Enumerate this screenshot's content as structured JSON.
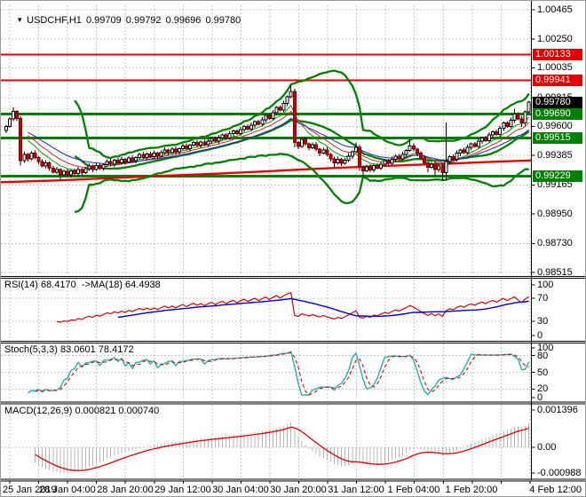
{
  "title": {
    "dropdown_icon": "▼",
    "symbol_period": "USDCHF,H1",
    "open": "0.99709",
    "high": "0.99792",
    "low": "0.99696",
    "close": "0.99780"
  },
  "indicator_labels": {
    "rsi": "RSI(14) 68.4170  ->MA(18) 64.4938",
    "stoch": "Stoch(5,3,3) 83.0601 78.4172",
    "macd": "MACD(12,26,9) 0.000821 0.000740"
  },
  "colors": {
    "background": "#ffffff",
    "grid": "#c6c6c6",
    "resistance_line": "#e60000",
    "support_line": "#008000",
    "current_price_badge_bg": "#000000",
    "bull_body": "#ffffff",
    "bear_body": "#d40000",
    "bear_border": "#7a0000",
    "candle_outline": "#000000",
    "band_green": "#008000",
    "ribbon_fast": "#00a000",
    "ribbon_mid": "#dd2222",
    "ribbon_slow": "#2222cc",
    "slow_ma_red": "#e60000",
    "rsi_line": "#dd0000",
    "rsi_ma_line": "#0000cc",
    "stoch_k": "#20b2aa",
    "stoch_d": "#e00000",
    "macd_histogram": "#b4b4b4",
    "macd_signal": "#e00000",
    "panel_border": "#000000"
  },
  "chart_data": {
    "type": "candlestick",
    "symbol": "USDCHF",
    "timeframe": "H1",
    "price_axis_ticks": [
      {
        "label": "1.00465",
        "value": 1.00465
      },
      {
        "label": "1.00250",
        "value": 1.0025
      },
      {
        "label": "1.00035",
        "value": 1.00035
      },
      {
        "label": "0.99815",
        "value": 0.99815
      },
      {
        "label": "0.99600",
        "value": 0.996
      },
      {
        "label": "0.99385",
        "value": 0.99385
      },
      {
        "label": "0.99165",
        "value": 0.99165
      },
      {
        "label": "0.98950",
        "value": 0.9895
      },
      {
        "label": "0.98730",
        "value": 0.9873
      },
      {
        "label": "0.98515",
        "value": 0.98515
      }
    ],
    "time_axis_ticks": [
      "25 Jan 2019",
      "28 Jan 04:00",
      "28 Jan 20:00",
      "29 Jan 12:00",
      "30 Jan 04:00",
      "30 Jan 20:00",
      "31 Jan 12:00",
      "1 Feb 04:00",
      "1 Feb 20:00",
      "4 Feb 12:00"
    ],
    "levels": [
      {
        "label": "1.00133",
        "value": 1.00133,
        "color": "#e60000",
        "width": 2,
        "kind": "resistance"
      },
      {
        "label": "0.99941",
        "value": 0.99941,
        "color": "#e60000",
        "width": 2,
        "kind": "resistance"
      },
      {
        "label": "0.99690",
        "value": 0.9969,
        "color": "#008000",
        "width": 3,
        "kind": "support"
      },
      {
        "label": "0.99515",
        "value": 0.99515,
        "color": "#008000",
        "width": 3,
        "kind": "support"
      },
      {
        "label": "0.99229",
        "value": 0.99229,
        "color": "#008000",
        "width": 3,
        "kind": "support"
      }
    ],
    "current_price": {
      "label": "0.99780",
      "value": 0.9978
    },
    "candles": {
      "open_first": 0.9957,
      "closes": [
        0.996,
        0.99655,
        0.9971,
        0.9966,
        0.99345,
        0.9939,
        0.9936,
        0.994,
        0.9937,
        0.9934,
        0.99305,
        0.9933,
        0.9929,
        0.9926,
        0.9928,
        0.9924,
        0.99265,
        0.9924,
        0.9927,
        0.9925,
        0.9928,
        0.99255,
        0.99285,
        0.99305,
        0.9928,
        0.9931,
        0.9929,
        0.99315,
        0.9934,
        0.9932,
        0.9935,
        0.9933,
        0.99355,
        0.99335,
        0.99365,
        0.99345,
        0.9937,
        0.9939,
        0.9937,
        0.99395,
        0.99375,
        0.994,
        0.9938,
        0.99405,
        0.99425,
        0.99405,
        0.9943,
        0.9941,
        0.99435,
        0.99455,
        0.99435,
        0.9946,
        0.9948,
        0.9946,
        0.99485,
        0.99465,
        0.9949,
        0.9951,
        0.9949,
        0.99515,
        0.99535,
        0.99515,
        0.99545,
        0.99565,
        0.99545,
        0.99575,
        0.996,
        0.9958,
        0.9961,
        0.99635,
        0.99615,
        0.9965,
        0.9968,
        0.9966,
        0.997,
        0.9974,
        0.9972,
        0.9977,
        0.9982,
        0.9986,
        0.9948,
        0.9945,
        0.99505,
        0.9947,
        0.9944,
        0.99465,
        0.9943,
        0.994,
        0.99425,
        0.9939,
        0.9936,
        0.9933,
        0.99355,
        0.99325,
        0.9935,
        0.9938,
        0.9941,
        0.99445,
        0.993,
        0.9927,
        0.993,
        0.99275,
        0.9931,
        0.9929,
        0.9932,
        0.99345,
        0.99325,
        0.99355,
        0.9938,
        0.9936,
        0.9939,
        0.9942,
        0.99455,
        0.9943,
        0.994,
        0.99365,
        0.9933,
        0.99295,
        0.9932,
        0.9928,
        0.99305,
        0.99255,
        0.9934,
        0.99375,
        0.99355,
        0.994,
        0.99425,
        0.99405,
        0.99445,
        0.9947,
        0.9945,
        0.9949,
        0.99515,
        0.99495,
        0.99535,
        0.9956,
        0.9954,
        0.99585,
        0.99625,
        0.996,
        0.99645,
        0.9969,
        0.99655,
        0.99625,
        0.99709,
        0.9978
      ],
      "wicks": {
        "2": {
          "h": 0.9974
        },
        "4": {
          "l": 0.9931
        },
        "15": {
          "l": 0.99195
        },
        "79": {
          "h": 0.99905
        },
        "80": {
          "l": 0.99445
        },
        "91": {
          "l": 0.9929
        },
        "97": {
          "h": 0.9948
        },
        "98": {
          "l": 0.9927
        },
        "99": {
          "l": 0.99225
        },
        "112": {
          "h": 0.99505
        },
        "117": {
          "l": 0.9926
        },
        "119": {
          "l": 0.9923
        },
        "121": {
          "l": 0.99195
        },
        "122": {
          "h": 0.9963,
          "l": 0.992
        },
        "141": {
          "h": 0.9973
        },
        "143": {
          "l": 0.99595
        },
        "145": {
          "h": 0.99792,
          "l": 0.99696
        }
      }
    },
    "slow_red_ma_points": [
      [
        0,
        0.99185
      ],
      [
        60,
        0.99198
      ],
      [
        120,
        0.99215
      ],
      [
        180,
        0.99232
      ],
      [
        240,
        0.99248
      ],
      [
        300,
        0.99266
      ],
      [
        340,
        0.9928
      ],
      [
        380,
        0.99292
      ],
      [
        440,
        0.99308
      ],
      [
        500,
        0.99322
      ],
      [
        560,
        0.99338
      ],
      [
        597,
        0.99347
      ]
    ],
    "indicators": {
      "bollinger": {
        "period": 20,
        "deviation": 2.8
      },
      "ema_ribbon_periods": [
        8,
        13,
        21
      ],
      "rsi": {
        "period": 14,
        "ma_period": 18,
        "value": 68.417,
        "ma_value": 64.4938,
        "scale_labels": [
          {
            "label": "100",
            "value": 100
          },
          {
            "label": "70",
            "value": 70
          },
          {
            "label": "30",
            "value": 30
          },
          {
            "label": "0",
            "value": 0
          }
        ],
        "level_lines": [
          70,
          30
        ]
      },
      "stoch": {
        "k": 5,
        "d": 3,
        "slowing": 3,
        "value": 83.0601,
        "signal_value": 78.4172,
        "scale_labels": [
          {
            "label": "100",
            "value": 100
          },
          {
            "label": "80",
            "value": 80
          },
          {
            "label": "50",
            "value": 50
          },
          {
            "label": "20",
            "value": 20
          },
          {
            "label": "0",
            "value": 0
          }
        ],
        "level_lines": [
          80,
          50,
          20
        ]
      },
      "macd": {
        "fast": 12,
        "slow": 26,
        "signal": 9,
        "value": 0.000821,
        "signal_value": 0.00074,
        "scale_labels": [
          {
            "label": "0.001396",
            "value": 0.001396
          },
          {
            "label": "0.00",
            "value": 0
          },
          {
            "label": "-0.000988",
            "value": -0.000988
          }
        ],
        "level_lines": [
          0
        ]
      }
    }
  }
}
